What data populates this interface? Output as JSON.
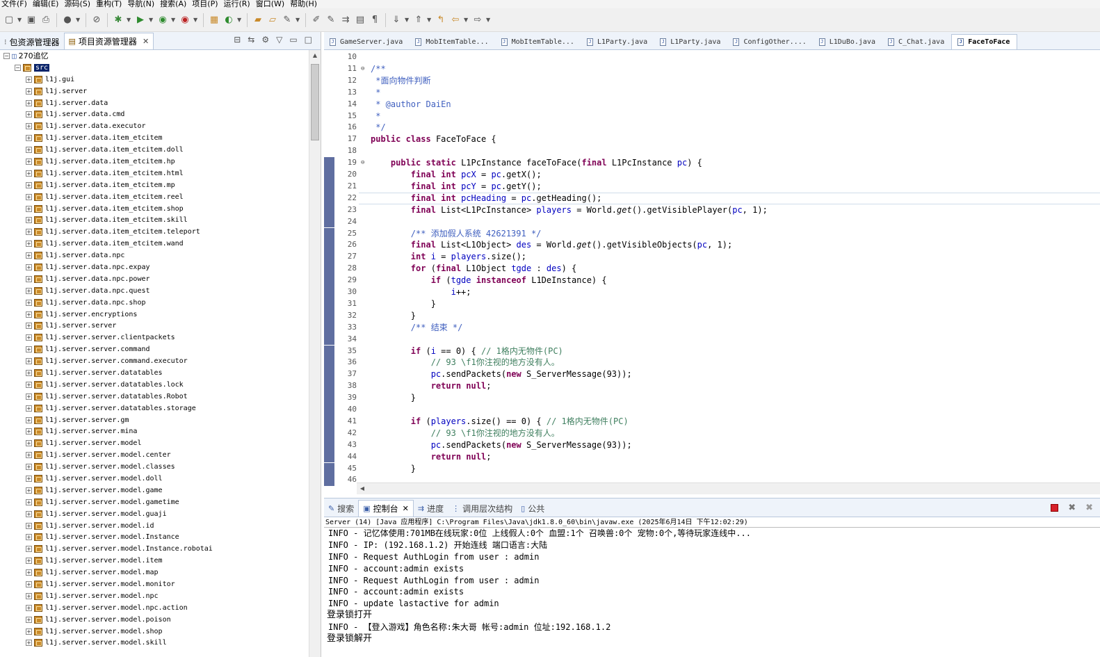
{
  "menu": [
    "文件(F)",
    "编辑(E)",
    "源码(S)",
    "重构(T)",
    "导航(N)",
    "搜索(A)",
    "项目(P)",
    "运行(R)",
    "窗口(W)",
    "帮助(H)"
  ],
  "left_panel": {
    "tabs": [
      {
        "label": "包资源管理器",
        "active": false
      },
      {
        "label": "项目资源管理器",
        "active": true
      }
    ],
    "project_name": "270追忆",
    "src_folder": "src",
    "packages": [
      "l1j.gui",
      "l1j.server",
      "l1j.server.data",
      "l1j.server.data.cmd",
      "l1j.server.data.executor",
      "l1j.server.data.item_etcitem",
      "l1j.server.data.item_etcitem.doll",
      "l1j.server.data.item_etcitem.hp",
      "l1j.server.data.item_etcitem.html",
      "l1j.server.data.item_etcitem.mp",
      "l1j.server.data.item_etcitem.reel",
      "l1j.server.data.item_etcitem.shop",
      "l1j.server.data.item_etcitem.skill",
      "l1j.server.data.item_etcitem.teleport",
      "l1j.server.data.item_etcitem.wand",
      "l1j.server.data.npc",
      "l1j.server.data.npc.expay",
      "l1j.server.data.npc.power",
      "l1j.server.data.npc.quest",
      "l1j.server.data.npc.shop",
      "l1j.server.encryptions",
      "l1j.server.server",
      "l1j.server.server.clientpackets",
      "l1j.server.server.command",
      "l1j.server.server.command.executor",
      "l1j.server.server.datatables",
      "l1j.server.server.datatables.lock",
      "l1j.server.server.datatables.Robot",
      "l1j.server.server.datatables.storage",
      "l1j.server.server.gm",
      "l1j.server.server.mina",
      "l1j.server.server.model",
      "l1j.server.server.model.center",
      "l1j.server.server.model.classes",
      "l1j.server.server.model.doll",
      "l1j.server.server.model.game",
      "l1j.server.server.model.gametime",
      "l1j.server.server.model.guaji",
      "l1j.server.server.model.id",
      "l1j.server.server.model.Instance",
      "l1j.server.server.model.Instance.robotai",
      "l1j.server.server.model.item",
      "l1j.server.server.model.map",
      "l1j.server.server.model.monitor",
      "l1j.server.server.model.npc",
      "l1j.server.server.model.npc.action",
      "l1j.server.server.model.poison",
      "l1j.server.server.model.shop",
      "l1j.server.server.model.skill"
    ]
  },
  "editor": {
    "tabs": [
      {
        "label": "GameServer.java",
        "active": false
      },
      {
        "label": "MobItemTable...",
        "active": false
      },
      {
        "label": "MobItemTable...",
        "active": false
      },
      {
        "label": "L1Party.java",
        "active": false
      },
      {
        "label": "L1Party.java",
        "active": false
      },
      {
        "label": "ConfigOther....",
        "active": false
      },
      {
        "label": "L1DuBo.java",
        "active": false
      },
      {
        "label": "C_Chat.java",
        "active": false
      },
      {
        "label": "FaceToFace",
        "active": true
      }
    ],
    "current_line": 22,
    "lines": [
      {
        "n": "10",
        "html": ""
      },
      {
        "n": "11",
        "fold": "⊖",
        "html": "<span class='cm'>/**</span>"
      },
      {
        "n": "12",
        "html": "<span class='cm'> *面向物件判断</span>"
      },
      {
        "n": "13",
        "html": "<span class='cm'> *</span>"
      },
      {
        "n": "14",
        "html": "<span class='cm'> * @author DaiEn</span>"
      },
      {
        "n": "15",
        "html": "<span class='cm'> *</span>"
      },
      {
        "n": "16",
        "html": "<span class='cm'> */</span>"
      },
      {
        "n": "17",
        "html": "<span class='kw'>public</span> <span class='kw'>class</span> FaceToFace {"
      },
      {
        "n": "18",
        "html": ""
      },
      {
        "n": "19",
        "fold": "⊖",
        "mark": true,
        "html": "    <span class='kw'>public</span> <span class='kw'>static</span> L1PcInstance faceToFace(<span class='kw'>final</span> L1PcInstance <span class='fld'>pc</span>) {"
      },
      {
        "n": "20",
        "mark": true,
        "html": "        <span class='kw'>final</span> <span class='kw'>int</span> <span class='fld'>pcX</span> = <span class='fld'>pc</span>.getX();"
      },
      {
        "n": "21",
        "mark": true,
        "html": "        <span class='kw'>final</span> <span class='kw'>int</span> <span class='fld'>pcY</span> = <span class='fld'>pc</span>.getY();"
      },
      {
        "n": "22",
        "mark": true,
        "html": "        <span class='kw'>final</span> <span class='kw'>int</span> <span class='fld'>pcHeading</span> = <span class='fld'>pc</span>.getHeading();"
      },
      {
        "n": "23",
        "mark": true,
        "html": "        <span class='kw'>final</span> List&lt;L1PcInstance&gt; <span class='fld'>players</span> = World.<span class='it'>get</span>().getVisiblePlayer(<span class='fld'>pc</span>, 1);"
      },
      {
        "n": "24",
        "mark": true,
        "html": ""
      },
      {
        "n": "25",
        "mark": true,
        "html": "        <span class='cm'>/** 添加假人系统 42621391 */</span>"
      },
      {
        "n": "26",
        "mark": true,
        "html": "        <span class='kw'>final</span> List&lt;L1Object&gt; <span class='fld'>des</span> = World.<span class='it'>get</span>().getVisibleObjects(<span class='fld'>pc</span>, 1);"
      },
      {
        "n": "27",
        "mark": true,
        "html": "        <span class='kw'>int</span> <span class='fld'>i</span> = <span class='fld'>players</span>.size();"
      },
      {
        "n": "28",
        "mark": true,
        "html": "        <span class='kw'>for</span> (<span class='kw'>final</span> L1Object <span class='fld'>tgde</span> : <span class='fld'>des</span>) {"
      },
      {
        "n": "29",
        "mark": true,
        "html": "            <span class='kw'>if</span> (<span class='fld'>tgde</span> <span class='kw'>instanceof</span> L1DeInstance) {"
      },
      {
        "n": "30",
        "mark": true,
        "html": "                <span class='fld'>i</span>++;"
      },
      {
        "n": "31",
        "mark": true,
        "html": "            }"
      },
      {
        "n": "32",
        "mark": true,
        "html": "        }"
      },
      {
        "n": "33",
        "mark": true,
        "html": "        <span class='cm'>/** 结束 */</span>"
      },
      {
        "n": "34",
        "mark": true,
        "html": ""
      },
      {
        "n": "35",
        "mark": true,
        "html": "        <span class='kw'>if</span> (<span class='fld'>i</span> == 0) { <span class='lc'>// 1格内无物件(PC)</span>"
      },
      {
        "n": "36",
        "mark": true,
        "html": "            <span class='lc'>// 93 \\f1你注视的地方没有人。</span>"
      },
      {
        "n": "37",
        "mark": true,
        "html": "            <span class='fld'>pc</span>.sendPackets(<span class='kw'>new</span> S_ServerMessage(93));"
      },
      {
        "n": "38",
        "mark": true,
        "html": "            <span class='kw'>return</span> <span class='kw'>null</span>;"
      },
      {
        "n": "39",
        "mark": true,
        "html": "        }"
      },
      {
        "n": "40",
        "mark": true,
        "html": ""
      },
      {
        "n": "41",
        "mark": true,
        "html": "        <span class='kw'>if</span> (<span class='fld'>players</span>.size() == 0) { <span class='lc'>// 1格内无物件(PC)</span>"
      },
      {
        "n": "42",
        "mark": true,
        "html": "            <span class='lc'>// 93 \\f1你注视的地方没有人。</span>"
      },
      {
        "n": "43",
        "mark": true,
        "html": "            <span class='fld'>pc</span>.sendPackets(<span class='kw'>new</span> S_ServerMessage(93));"
      },
      {
        "n": "44",
        "mark": true,
        "html": "            <span class='kw'>return</span> <span class='kw'>null</span>;"
      },
      {
        "n": "45",
        "mark": true,
        "html": "        }"
      },
      {
        "n": "46",
        "mark": true,
        "html": ""
      }
    ]
  },
  "console": {
    "tabs": [
      {
        "label": "搜索",
        "icon": "search-icon",
        "active": false
      },
      {
        "label": "控制台",
        "icon": "console-icon",
        "active": true
      },
      {
        "label": "进度",
        "icon": "progress-icon",
        "active": false
      },
      {
        "label": "调用层次结构",
        "icon": "call-hierarchy-icon",
        "active": false
      },
      {
        "label": "公共",
        "icon": "clipboard-icon",
        "active": false
      }
    ],
    "title": "Server (14) [Java 应用程序] C:\\Program Files\\Java\\jdk1.8.0_60\\bin\\javaw.exe (2025年6月14日 下午12:02:29)",
    "lines": [
      {
        "text": "INFO - 记忆体使用:701MB在线玩家:0位 上线假人:0个 血盟:1个 召唤兽:0个 宠物:0个,等待玩家连线中...",
        "plain": false
      },
      {
        "text": "INFO - IP: (192.168.1.2) 开始连线 端口语言:大陆",
        "plain": false
      },
      {
        "text": "INFO - Request AuthLogin from user : admin",
        "plain": false
      },
      {
        "text": "INFO - account:admin exists",
        "plain": false
      },
      {
        "text": "INFO - Request AuthLogin from user : admin",
        "plain": false
      },
      {
        "text": "INFO - account:admin exists",
        "plain": false
      },
      {
        "text": "INFO - update lastactive for admin",
        "plain": false
      },
      {
        "text": "登录锁打开",
        "plain": true
      },
      {
        "text": "INFO - 【登入游戏】角色名称:朱大哥 帐号:admin 位址:192.168.1.2",
        "plain": false
      },
      {
        "text": "登录锁解开",
        "plain": true
      }
    ]
  }
}
